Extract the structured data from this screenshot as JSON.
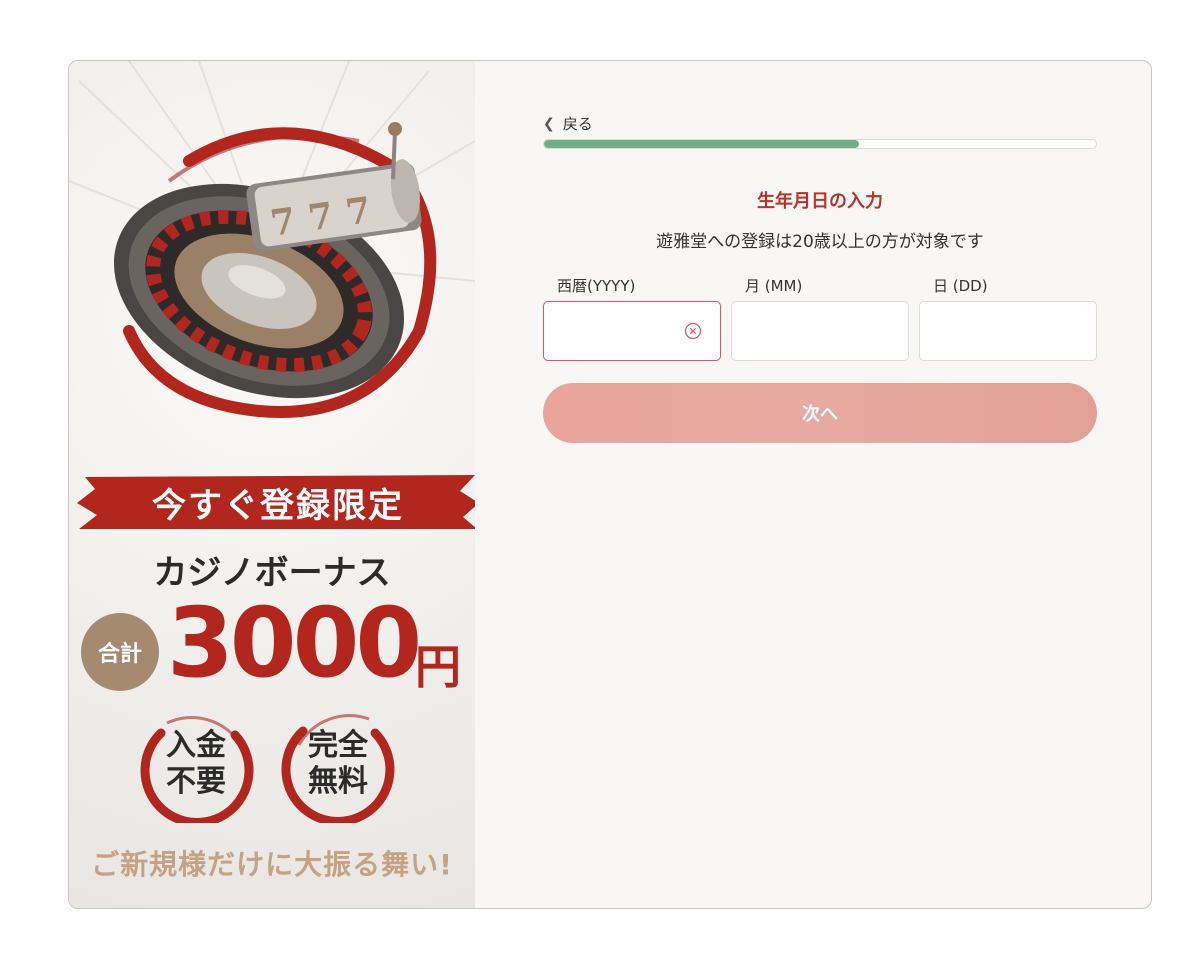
{
  "promo": {
    "reel_digits": [
      "7",
      "7",
      "7"
    ],
    "banner": "今すぐ登録限定",
    "bonus_title": "カジノボーナス",
    "total_badge": "合計",
    "amount": "3000",
    "currency": "円",
    "seal_left": [
      "入金",
      "不要"
    ],
    "seal_right": [
      "完全",
      "無料"
    ],
    "tagline": "ご新規様だけに大振る舞い!"
  },
  "form": {
    "back_label": "戻る",
    "progress_percent": 57,
    "heading": "生年月日の入力",
    "subheading": "遊雅堂への登録は20歳以上の方が対象です",
    "fields": [
      {
        "label": "西暦(YYYY)",
        "value": "",
        "state": "error"
      },
      {
        "label": "月 (MM)",
        "value": ""
      },
      {
        "label": "日 (DD)",
        "value": ""
      }
    ],
    "next_label": "次へ"
  },
  "colors": {
    "accent_red": "#b8342a",
    "progress_green": "#6fb08a",
    "button_pink": "#e8a79c",
    "error_border": "#e0546a",
    "badge_brown": "#a58a6f",
    "tagline_gold": "#c4a383"
  }
}
